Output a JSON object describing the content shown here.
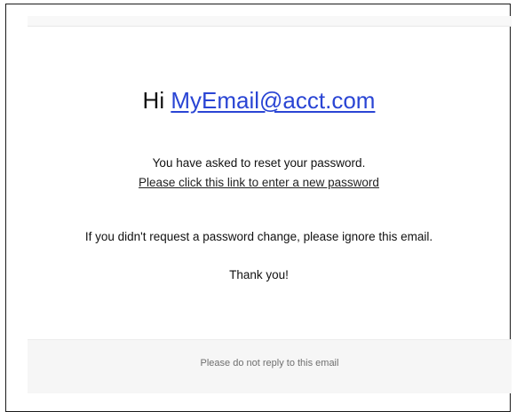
{
  "email": {
    "greeting_prefix": "Hi",
    "recipient_email": "MyEmail@acct.com",
    "message_reset": "You have asked to reset your password.",
    "reset_link_text": "Please click this link to enter a new password",
    "ignore_notice": "If you didn't request a password change, please ignore this email.",
    "thanks": "Thank you!",
    "footer_note": "Please do not reply to this email"
  },
  "colors": {
    "link_blue": "#2a45d4",
    "text": "#111111",
    "footer_text": "#6f6f6f",
    "footer_bg": "#f6f6f6"
  }
}
